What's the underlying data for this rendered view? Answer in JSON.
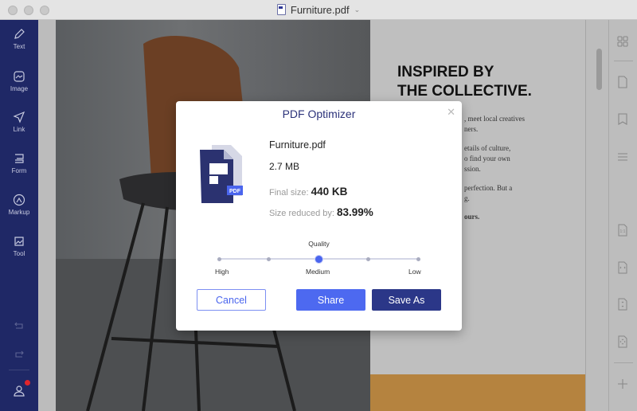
{
  "window": {
    "title": "Furniture.pdf",
    "icon": "pdf-document-icon",
    "dropdown_icon": "chevron-down-icon"
  },
  "sidebar": {
    "items": [
      {
        "label": "Text",
        "icon": "pencil-icon"
      },
      {
        "label": "Image",
        "icon": "image-icon"
      },
      {
        "label": "Link",
        "icon": "send-icon"
      },
      {
        "label": "Form",
        "icon": "form-icon"
      },
      {
        "label": "Markup",
        "icon": "markup-icon"
      },
      {
        "label": "Tool",
        "icon": "toolbox-icon"
      }
    ],
    "bottom": [
      "undo-icon",
      "redo-icon",
      "user-icon"
    ],
    "notification_color": "#e0252b"
  },
  "document": {
    "headline": [
      "INSPIRED BY",
      "THE COLLECTIVE."
    ],
    "body": [
      ", meet local creatives",
      "ners.",
      "etails of culture,",
      "o find your own",
      "ssion.",
      "perfection. But a",
      "g.",
      "ours."
    ]
  },
  "right_panel": {
    "icons": [
      "thumbnails-icon",
      "page-icon",
      "bookmark-icon",
      "outline-icon",
      "actual-size-icon",
      "fit-width-icon",
      "fit-height-icon",
      "fit-page-icon",
      "zoom-in-icon"
    ]
  },
  "dialog": {
    "title": "PDF Optimizer",
    "file_name": "Furniture.pdf",
    "file_size": "2.7 MB",
    "final_size_label": "Final size:",
    "final_size": "440 KB",
    "reduced_label": "Size reduced by:",
    "reduced": "83.99%",
    "quality_label": "Quality",
    "quality_levels": [
      "High",
      "Medium",
      "Low"
    ],
    "quality_selected": "Medium",
    "slider_steps": 5,
    "slider_index": 2,
    "buttons": {
      "cancel": "Cancel",
      "share": "Share",
      "save_as": "Save As"
    },
    "colors": {
      "accent": "#4a65ee",
      "primary": "#2b3788",
      "title": "#2b327a"
    }
  }
}
